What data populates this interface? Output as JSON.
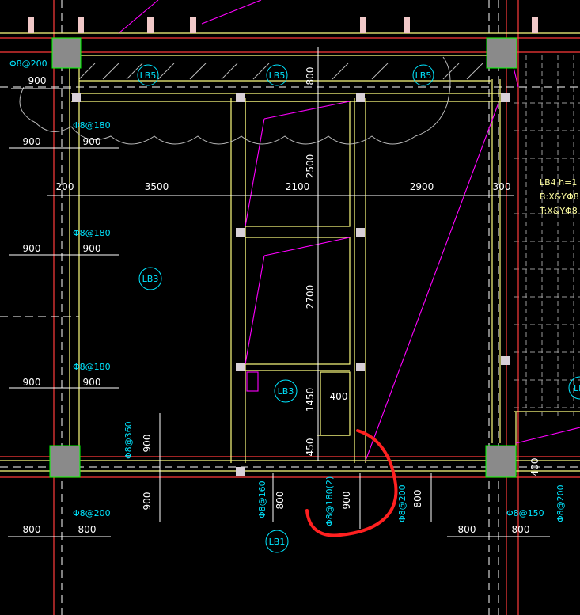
{
  "colors": {
    "background": "#000000",
    "wall": "#ffff80",
    "gridline_red": "#ff3b3b",
    "gridline_white": "#ffffff",
    "dim_text": "#ffffff",
    "rebar_cyan": "#00e5ff",
    "diag_magenta": "#ff00ff",
    "column_fill": "#8a8a8a",
    "column_edge": "#00ff00",
    "annotation_red": "#ff2020"
  },
  "top_dims": {
    "d200": "200",
    "d3500": "3500",
    "d2100": "2100",
    "d2900": "2900",
    "d300": "300"
  },
  "vertical_dims": {
    "d800_top": "800",
    "d2500": "2500",
    "d2700": "2700",
    "d1450": "1450",
    "d450": "450",
    "d400": "400"
  },
  "slabs": {
    "lb5_a": "LB5",
    "lb5_b": "LB5",
    "lb5_c": "LB5",
    "lb3_a": "LB3",
    "lb3_b": "LB3",
    "lb1": "LB1",
    "lb_right": "LB"
  },
  "rebar_left": {
    "top_spec": "Φ8@200",
    "top_dim": "900",
    "r1_spec": "Φ8@180",
    "r1_d1": "900",
    "r1_d2": "900",
    "r2_spec": "Φ8@180",
    "r2_d1": "900",
    "r2_d2": "900",
    "r3_spec": "Φ8@180",
    "r3_d1": "900",
    "r3_d2": "900",
    "vert_spec": "Φ8@360",
    "vert_dim": "900",
    "bot_dim": "900",
    "bot_spec": "Φ8@200",
    "bot_d1": "800",
    "bot_d2": "800"
  },
  "rebar_bottom": {
    "mid_spec": "Φ8@160",
    "mid_dim": "800",
    "circled_spec": "Φ8@180(2)",
    "circled_dim": "900",
    "right_spec": "Φ8@200",
    "right_dim": "800",
    "far_spec": "Φ8@150",
    "far_d1": "800",
    "far_d2": "800",
    "edge_spec": "Φ8@200",
    "edge_dim": "400"
  },
  "right_note": {
    "line1": "LB4  h=1",
    "line2": "B:X&YΦ8",
    "line3": "T:X&YΦ8"
  }
}
